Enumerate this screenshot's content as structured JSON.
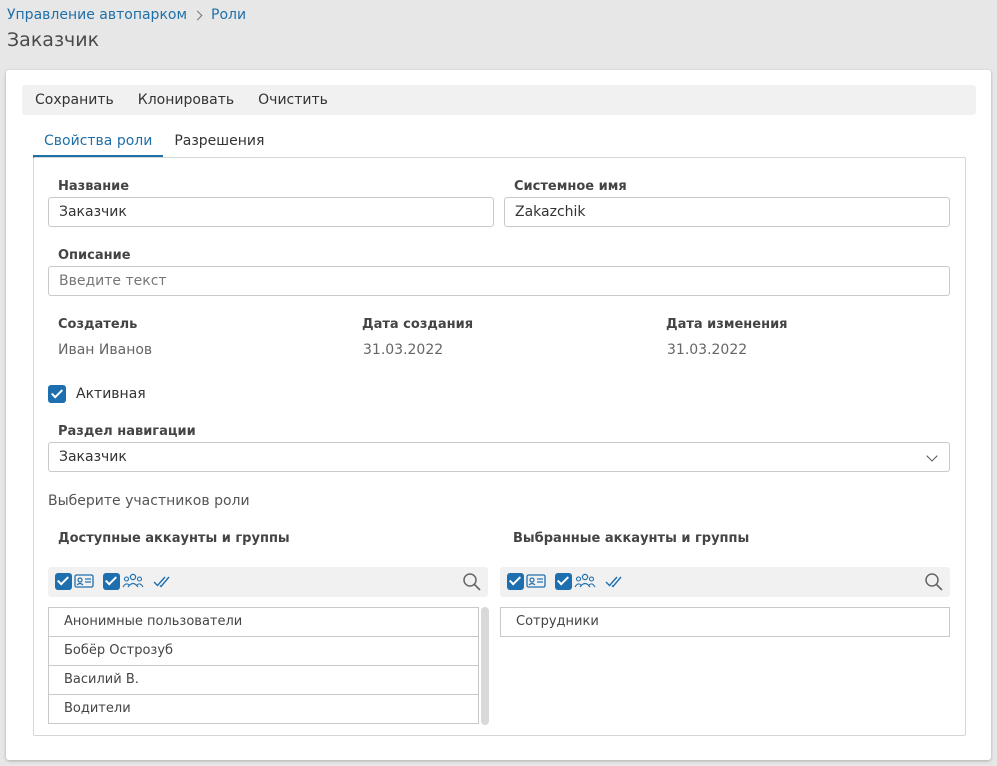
{
  "breadcrumb": {
    "root": "Управление автопарком",
    "current": "Роли"
  },
  "page": {
    "title": "Заказчик"
  },
  "toolbar": {
    "save": "Сохранить",
    "clone": "Клонировать",
    "clear": "Очистить"
  },
  "tabs": [
    {
      "label": "Свойства роли",
      "active": true
    },
    {
      "label": "Разрешения",
      "active": false
    }
  ],
  "form": {
    "name": {
      "label": "Название",
      "value": "Заказчик"
    },
    "system_name": {
      "label": "Системное имя",
      "value": "Zakazchik"
    },
    "description": {
      "label": "Описание",
      "placeholder": "Введите текст"
    },
    "creator": {
      "label": "Создатель",
      "value": "Иван Иванов"
    },
    "created": {
      "label": "Дата создания",
      "value": "31.03.2022"
    },
    "modified": {
      "label": "Дата изменения",
      "value": "31.03.2022"
    },
    "active": {
      "label": "Активная",
      "checked": true
    },
    "nav_section": {
      "label": "Раздел навигации",
      "value": "Заказчик"
    }
  },
  "members": {
    "heading": "Выберите участников роли",
    "available": {
      "title": "Доступные аккаунты и группы",
      "items": [
        "Анонимные пользователи",
        "Бобёр Острозуб",
        "Василий В.",
        "Водители"
      ]
    },
    "selected": {
      "title": "Выбранные аккаунты и группы",
      "items": [
        "Сотрудники"
      ]
    }
  },
  "colors": {
    "accent": "#1f6fa8",
    "checkbox": "#1e6fb0"
  },
  "icons": [
    "chevron-right-icon",
    "chevron-down-icon",
    "user-card-icon",
    "users-group-icon",
    "double-check-icon",
    "search-icon"
  ]
}
